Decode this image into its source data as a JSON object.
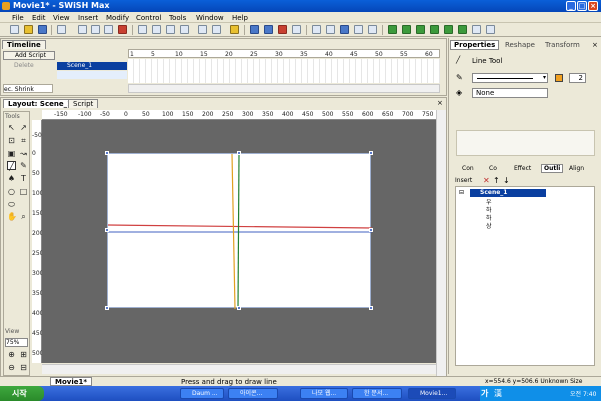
{
  "window": {
    "title": "Movie1* - SWiSH Max",
    "controls": [
      "_",
      "□",
      "×"
    ]
  },
  "menu": [
    "File",
    "Edit",
    "View",
    "Insert",
    "Modify",
    "Control",
    "Tools",
    "Window",
    "Help"
  ],
  "timeline": {
    "tab": "Timeline",
    "add_script": "Add Script",
    "delete": "Delete",
    "scene_label": "Scene_1",
    "action_label": "ec. Shrink",
    "ruler_ticks": [
      "1",
      "5",
      "10",
      "15",
      "20",
      "25",
      "30",
      "35",
      "40",
      "45",
      "50",
      "55",
      "60"
    ]
  },
  "layout": {
    "tab": "Layout: Scene_1",
    "script_tab": "Script",
    "tools_label": "Tools",
    "view_label": "View",
    "zoom": "75%",
    "hruler": [
      "-150",
      "-100",
      "-50",
      "0",
      "50",
      "100",
      "150",
      "200",
      "250",
      "300",
      "350",
      "400",
      "450",
      "500",
      "550",
      "600",
      "650",
      "700",
      "750"
    ],
    "vruler": [
      "-50",
      "0",
      "50",
      "100",
      "150",
      "200",
      "250",
      "300",
      "350",
      "400",
      "450",
      "500"
    ]
  },
  "status": {
    "tab": "Movie1*",
    "hint": "Press and drag to draw line",
    "coords": "x=554.6 y=506.6 Unknown Size"
  },
  "properties": {
    "tabs": [
      "Properties",
      "Reshape",
      "Transform"
    ],
    "tool_name": "Line Tool",
    "stroke_width": "2",
    "fill": "None"
  },
  "outline": {
    "tabs": [
      "Con",
      "Co",
      "Effect",
      "Outli",
      "Align"
    ],
    "insert": "Insert",
    "scene": "Scene_1",
    "items": [
      "우",
      "하",
      "하",
      "상"
    ]
  },
  "taskbar": {
    "start": "시작",
    "tasks": [
      "Daum ...",
      "아이콘...",
      "나모 웹...",
      "한 문서...",
      "Movie1..."
    ],
    "clock": "오전 7:40",
    "ime": "가",
    "ime_mode": "漢"
  },
  "colors": {
    "title": "#0a5fd8",
    "canvas": "#666666",
    "red_line": "#d04040",
    "blue_line": "#4060c0",
    "orange_line": "#e0a020",
    "green_line": "#208030"
  }
}
